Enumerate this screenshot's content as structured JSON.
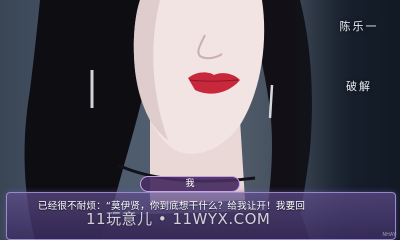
{
  "side_menu": {
    "items": [
      {
        "label": "陈乐一"
      },
      {
        "label": "破解"
      }
    ]
  },
  "dialogue": {
    "speaker": "我",
    "text": "已经很不耐烦：“莫伊贤，你到底想干什么？给我让开！我要回"
  },
  "watermark": {
    "text": "11玩意儿 • 11WYX.COM"
  },
  "corner_mark": {
    "text": "NHAY"
  },
  "colors": {
    "dialogue_border": "#b9a5eb",
    "name_tag_border": "#c7a2e6",
    "lip_color": "#c8283c"
  }
}
